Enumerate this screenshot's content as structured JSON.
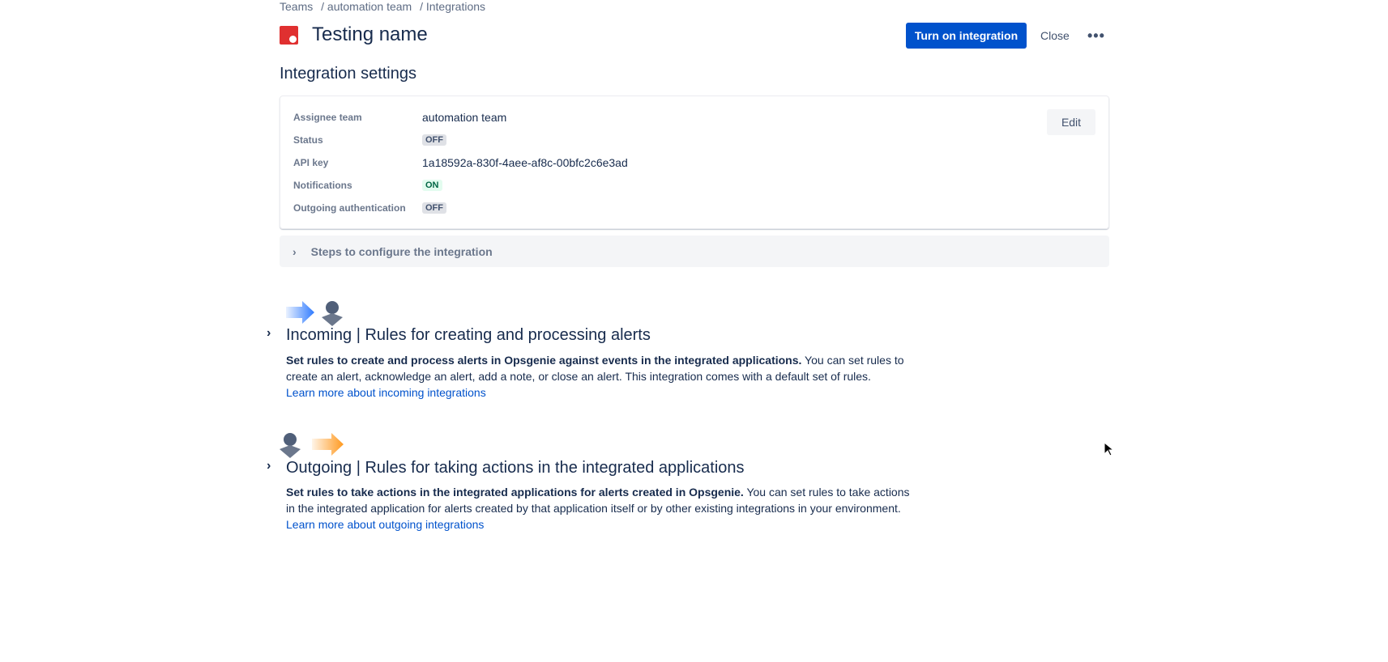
{
  "breadcrumb": [
    "Teams",
    "/ automation team",
    "/ Integrations"
  ],
  "header": {
    "title": "Testing name",
    "turn_on": "Turn on integration",
    "close": "Close",
    "more": "•••"
  },
  "settings": {
    "heading": "Integration settings",
    "edit": "Edit",
    "rows": [
      {
        "label": "Assignee team",
        "value": "automation team"
      },
      {
        "label": "Status",
        "value": "OFF"
      },
      {
        "label": "API key",
        "value": "1a18592a-830f-4aee-af8c-00bfc2c6e3ad"
      },
      {
        "label": "Notifications",
        "value": "ON"
      },
      {
        "label": "Outgoing authentication",
        "value": "OFF"
      }
    ]
  },
  "steps": {
    "label": "Steps to configure the integration"
  },
  "incoming": {
    "heading": "Incoming | Rules for creating and processing alerts",
    "bold": "Set rules to create and process alerts in Opsgenie against events in the integrated applications.",
    "text": " You can set rules to create an alert, acknowledge an alert, add a note, or close an alert. This integration comes with a default set of rules.",
    "link": "Learn more about incoming integrations"
  },
  "outgoing": {
    "heading": "Outgoing | Rules for taking actions in the integrated applications",
    "bold": "Set rules to take actions in the integrated applications for alerts created in Opsgenie.",
    "text": " You can set rules to take actions in the integrated application for alerts created by that application itself or by other existing integrations in your environment. ",
    "link": "Learn more about outgoing integrations"
  },
  "colors": {
    "primary": "#0052cc",
    "incoming_arrow": "#2f7bff",
    "outgoing_arrow": "#ff991f"
  }
}
